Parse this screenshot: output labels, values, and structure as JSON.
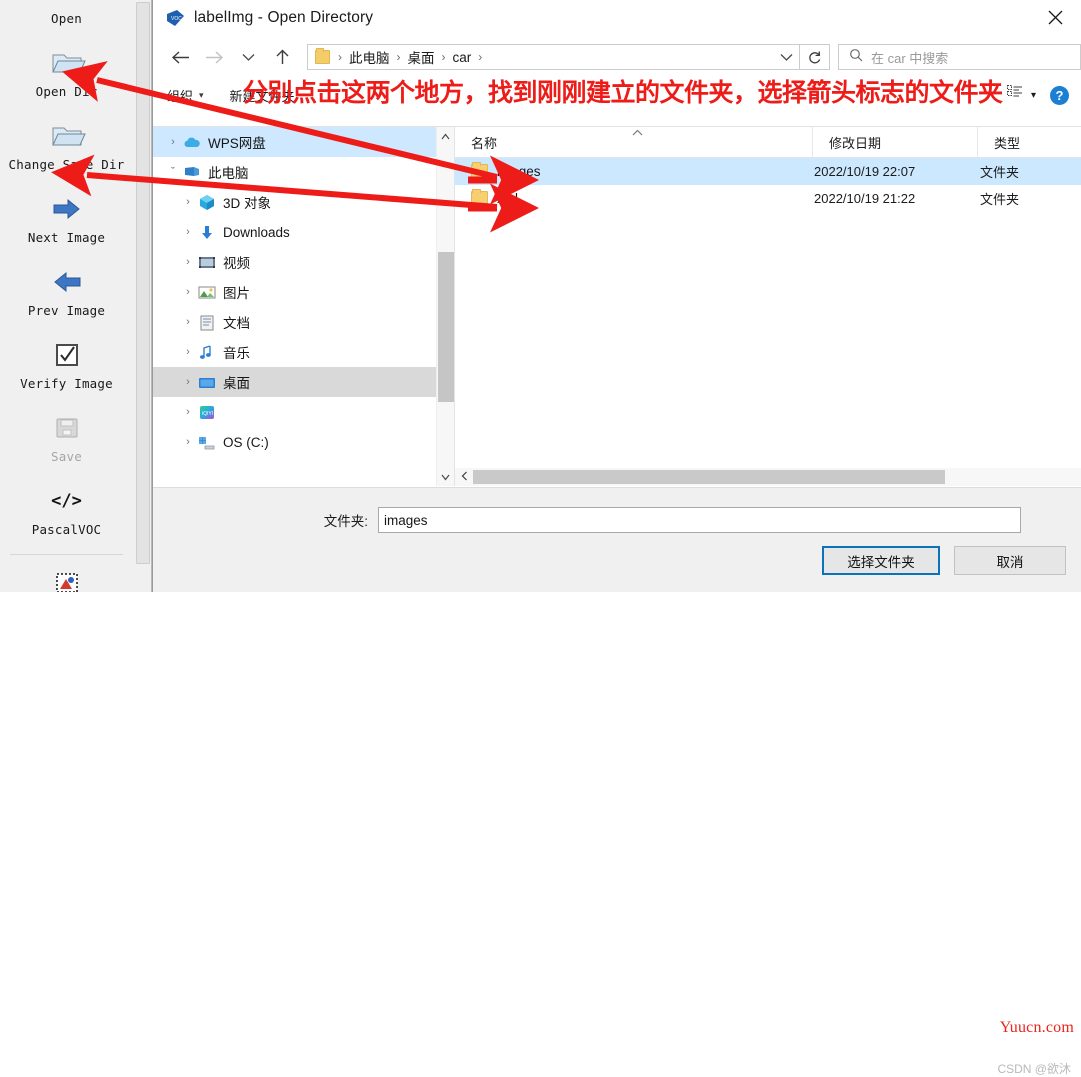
{
  "labelimg_toolbar": {
    "items": [
      {
        "label": "Open",
        "icon": "open-folder-icon",
        "enabled": true
      },
      {
        "label": "Open Dir",
        "icon": "open-folder-icon",
        "enabled": true
      },
      {
        "label": "Change Save Dir",
        "icon": "open-folder-icon",
        "enabled": true
      },
      {
        "label": "Next Image",
        "icon": "right-arrow-icon",
        "enabled": true
      },
      {
        "label": "Prev Image",
        "icon": "left-arrow-icon",
        "enabled": true
      },
      {
        "label": "Verify Image",
        "icon": "checkbox-checked-icon",
        "enabled": true
      },
      {
        "label": "Save",
        "icon": "floppy-disk-icon",
        "enabled": false
      },
      {
        "label": "PascalVOC",
        "icon": "code-brackets-icon",
        "enabled": true
      }
    ]
  },
  "dialog": {
    "title": "labelImg - Open Directory",
    "close_label": "✕",
    "nav": {
      "back": "←",
      "forward": "→",
      "recent": "ˇ",
      "up": "↑"
    },
    "breadcrumb": {
      "items": [
        "此电脑",
        "桌面",
        "car"
      ],
      "separator": "›",
      "chevron": "ˇ"
    },
    "refresh_label": "↻",
    "search": {
      "placeholder": "在 car 中搜索",
      "icon": "search-icon"
    },
    "command_bar": {
      "organize": "组织",
      "organize_caret": "▾",
      "new_folder": "新建文件夹",
      "view_caret": "▾",
      "help": "?"
    },
    "tree": {
      "items": [
        {
          "label": "WPS网盘",
          "icon": "cloud-icon",
          "indent": 0,
          "twisty": "›",
          "state": "highlight"
        },
        {
          "label": "此电脑",
          "icon": "computer-icon",
          "indent": 0,
          "twisty": "ˇ",
          "state": "normal"
        },
        {
          "label": "3D 对象",
          "icon": "3d-objects-icon",
          "indent": 1,
          "twisty": "›",
          "state": "normal"
        },
        {
          "label": "Downloads",
          "icon": "downloads-icon",
          "indent": 1,
          "twisty": "›",
          "state": "normal"
        },
        {
          "label": "视频",
          "icon": "videos-icon",
          "indent": 1,
          "twisty": "›",
          "state": "normal"
        },
        {
          "label": "图片",
          "icon": "pictures-icon",
          "indent": 1,
          "twisty": "›",
          "state": "normal"
        },
        {
          "label": "文档",
          "icon": "documents-icon",
          "indent": 1,
          "twisty": "›",
          "state": "normal"
        },
        {
          "label": "音乐",
          "icon": "music-icon",
          "indent": 1,
          "twisty": "›",
          "state": "normal"
        },
        {
          "label": "桌面",
          "icon": "desktop-icon",
          "indent": 1,
          "twisty": "›",
          "state": "selected"
        },
        {
          "label": "",
          "icon": "iqiyi-icon",
          "indent": 1,
          "twisty": "›",
          "state": "normal"
        },
        {
          "label": "OS (C:)",
          "icon": "drive-icon",
          "indent": 1,
          "twisty": "›",
          "state": "normal"
        }
      ]
    },
    "file_list": {
      "columns": [
        "名称",
        "修改日期",
        "类型"
      ],
      "sort_indicator": "˄",
      "rows": [
        {
          "name": "images",
          "date": "2022/10/19 22:07",
          "type": "文件夹",
          "selected": true
        },
        {
          "name": "xml",
          "date": "2022/10/19 21:22",
          "type": "文件夹",
          "selected": false
        }
      ]
    },
    "footer": {
      "folder_label": "文件夹:",
      "folder_value": "images",
      "choose_button": "选择文件夹",
      "cancel_button": "取消"
    }
  },
  "annotation": {
    "text": "分别点击这两个地方，找到刚刚建立的文件夹，选择箭头标志的文件夹",
    "color": "#ee1c18"
  },
  "watermarks": {
    "red": "Yuucn.com",
    "gray": "CSDN @欲沐"
  }
}
